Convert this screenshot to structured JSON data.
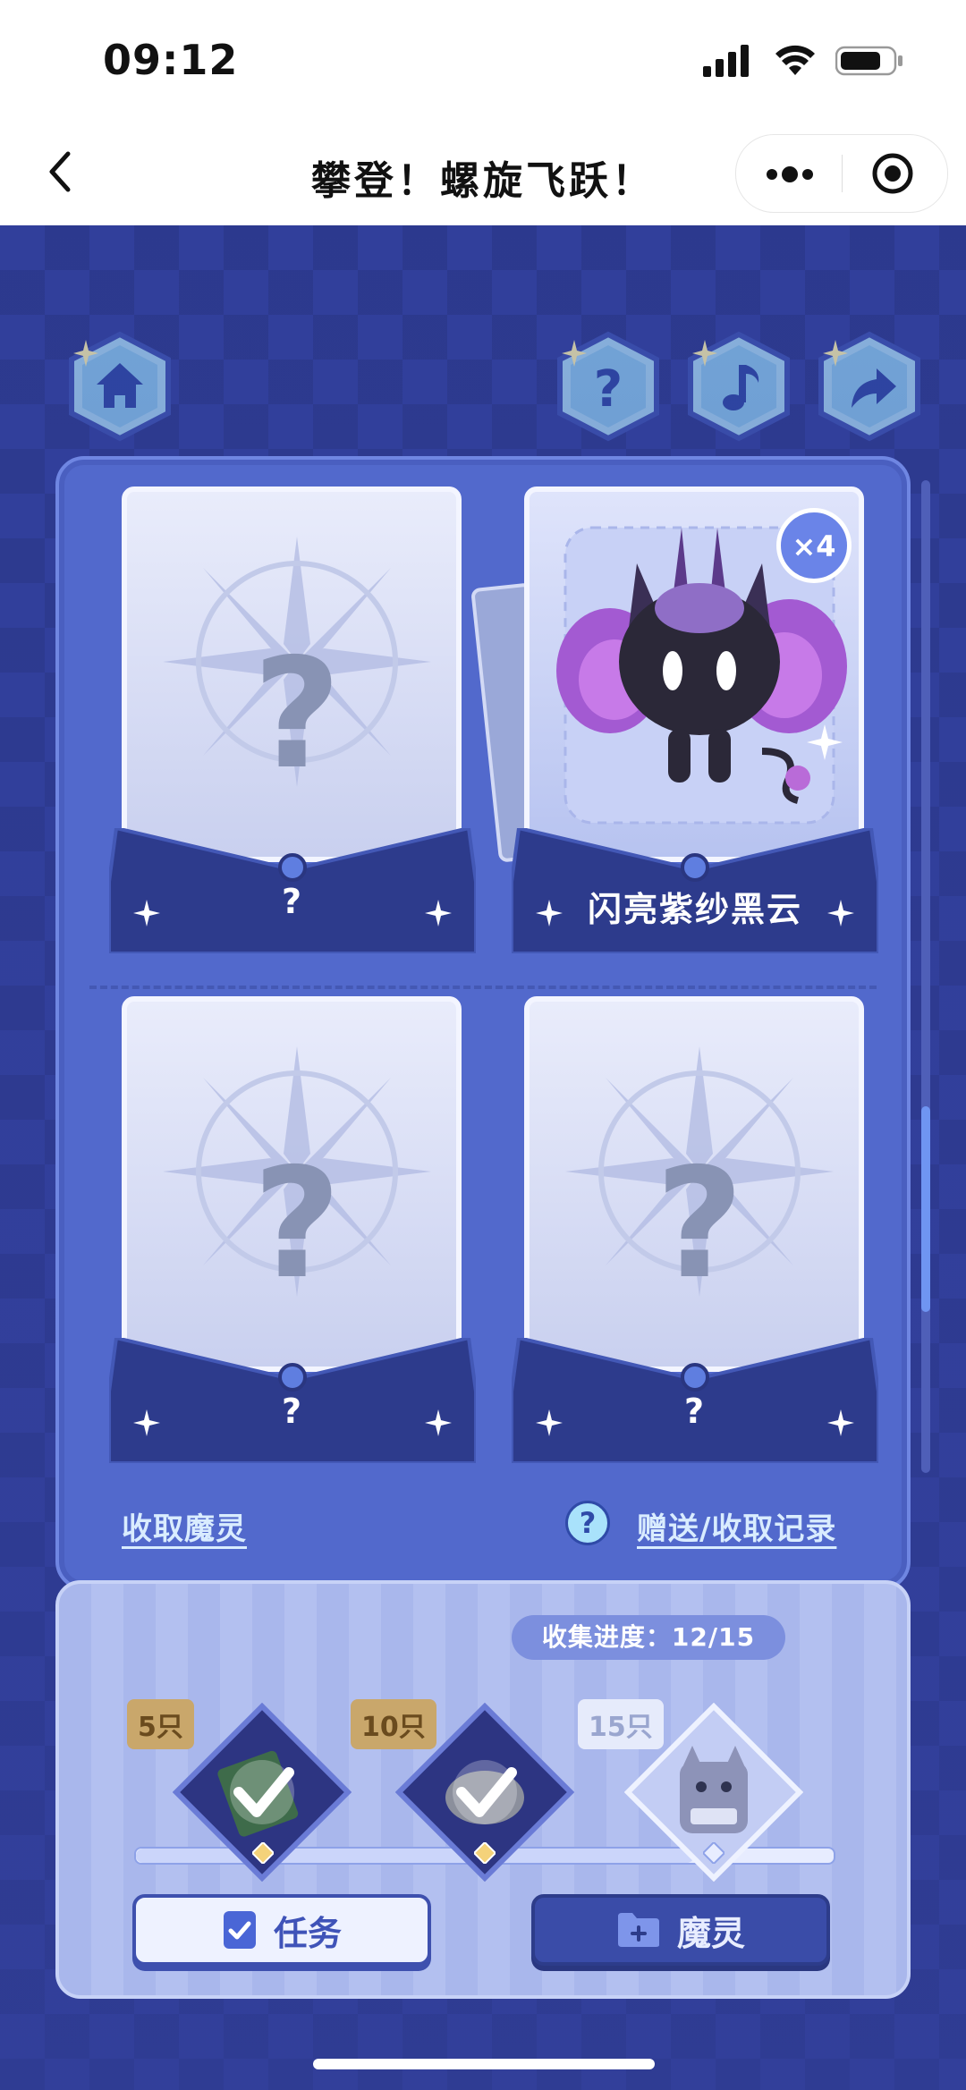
{
  "status_bar": {
    "time": "09:12"
  },
  "nav": {
    "title": "攀登！螺旋飞跃！"
  },
  "cards": [
    {
      "label": "?",
      "revealed": false
    },
    {
      "label": "闪亮紫纱黑云",
      "revealed": true,
      "count_badge": "×4"
    },
    {
      "label": "?",
      "revealed": false
    },
    {
      "label": "?",
      "revealed": false
    }
  ],
  "links": {
    "collect": "收取魔灵",
    "records": "赠送/收取记录"
  },
  "progress": {
    "label": "收集进度：",
    "value": "12/15",
    "fraction": 0.8
  },
  "milestones": [
    {
      "label": "5只",
      "achieved": true
    },
    {
      "label": "10只",
      "achieved": true
    },
    {
      "label": "15只",
      "achieved": false
    }
  ],
  "buttons": {
    "task": "任务",
    "pet": "魔灵"
  },
  "colors": {
    "accent": "#3e50ae",
    "panel": "#5269cc",
    "link": "#d9ecff"
  }
}
